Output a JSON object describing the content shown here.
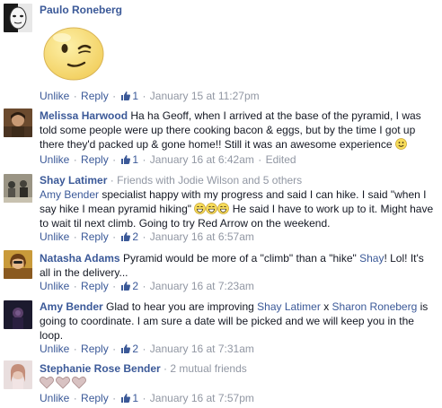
{
  "comments": [
    {
      "author": "Paulo Roneberg",
      "sticker_icon": "winking-face-sticker",
      "actions": {
        "unlike": "Unlike",
        "reply": "Reply",
        "likes": "1",
        "time": "January 15 at 11:27pm"
      }
    },
    {
      "author": "Melissa Harwood",
      "text": "Ha ha Geoff, when I arrived at the base of the pyramid, I was told some people were up there cooking bacon & eggs, but by the time I got up there they'd packed up & gone home!! Still it was an awesome experience",
      "emoji": "smile-emoji",
      "actions": {
        "unlike": "Unlike",
        "reply": "Reply",
        "likes": "1",
        "time": "January 16 at 6:42am",
        "edited": "Edited"
      }
    },
    {
      "author": "Shay Latimer",
      "context": "Friends with Jodie Wilson and 5 others",
      "mention": "Amy Bender",
      "text_part1": "specialist happy with my progress and said I can hike. I said \"when I say hike I mean pyramid hiking\"",
      "emoji": "grinning-emoji",
      "text_part2": "He said I have to work up to it. Might have to wait til next climb. Going to try Red Arrow on the weekend.",
      "actions": {
        "unlike": "Unlike",
        "reply": "Reply",
        "likes": "2",
        "time": "January 16 at 6:57am"
      }
    },
    {
      "author": "Natasha Adams",
      "text_part1": "Pyramid would be more of a \"climb\" than a \"hike\"",
      "mention": "Shay",
      "text_part2": "! Lol! It's all in the delivery...",
      "actions": {
        "unlike": "Unlike",
        "reply": "Reply",
        "likes": "2",
        "time": "January 16 at 7:23am"
      }
    },
    {
      "author": "Amy Bender",
      "text_part1": "Glad to hear you are improving",
      "mention1": "Shay Latimer",
      "connector": "x",
      "mention2": "Sharon Roneberg",
      "text_part2": "is going to coordinate. I am sure a date will be picked and we will keep you in the loop.",
      "actions": {
        "unlike": "Unlike",
        "reply": "Reply",
        "likes": "2",
        "time": "January 16 at 7:31am"
      }
    },
    {
      "author": "Stephanie Rose Bender",
      "context": "2 mutual friends",
      "hearts_icon": "heart-icon",
      "actions": {
        "unlike": "Unlike",
        "reply": "Reply",
        "likes": "1",
        "time": "January 16 at 7:57pm"
      }
    }
  ],
  "colors": {
    "link": "#3b5998",
    "meta": "#9197a3",
    "text": "#141823",
    "sticker_yellow": "#f7dc7e",
    "heart_fill": "#d8c2c2"
  }
}
